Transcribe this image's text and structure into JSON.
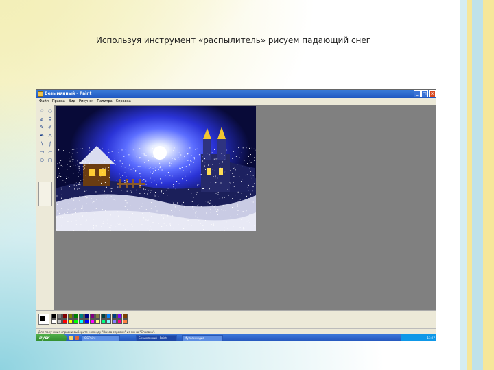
{
  "slide": {
    "title": "Используя инструмент «распылитель» рисуем падающий снег"
  },
  "window": {
    "title": "Безымянный - Paint",
    "menu": [
      "Файл",
      "Правка",
      "Вид",
      "Рисунок",
      "Палитра",
      "Справка"
    ],
    "status_text": "Для получения справки выберите команду \"Вызов справки\" из меню \"Справка\"."
  },
  "taskbar": {
    "start_label": "пуск",
    "items": [
      "OGPoint",
      "Безымянный - Paint",
      "Мультимедиа"
    ],
    "clock": "13:27"
  },
  "tools": [
    "☆",
    "◌",
    "⌀",
    "⚲",
    "✎",
    "✐",
    "✒",
    "A",
    "∖",
    "∫",
    "▭",
    "▱",
    "⬭",
    "▢"
  ],
  "palette": [
    "#000000",
    "#808080",
    "#800000",
    "#808000",
    "#008000",
    "#008080",
    "#000080",
    "#800080",
    "#808040",
    "#004040",
    "#0080ff",
    "#004080",
    "#8000ff",
    "#804000",
    "#ffffff",
    "#c0c0c0",
    "#ff0000",
    "#ffff00",
    "#00ff00",
    "#00ffff",
    "#0000ff",
    "#ff00ff",
    "#ffff80",
    "#00ff80",
    "#80ffff",
    "#8080ff",
    "#ff0080",
    "#ff8040"
  ],
  "colors": {
    "titlebar": "#2563c9",
    "workspace": "#808080",
    "sky": "#0a0d3a",
    "moon_glow": "#3a4cff"
  }
}
